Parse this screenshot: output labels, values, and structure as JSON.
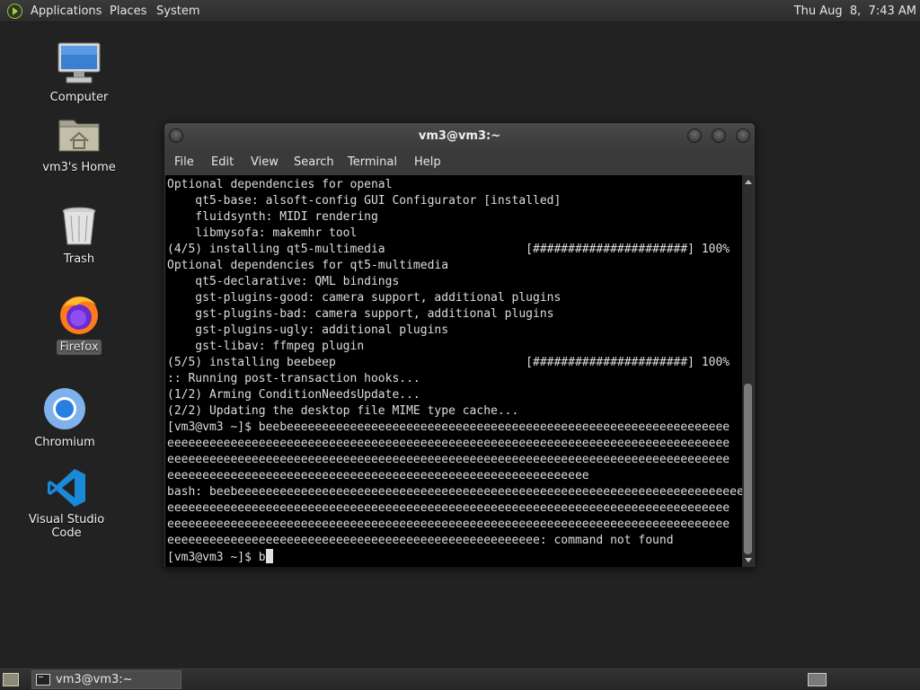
{
  "top_panel": {
    "menu_icon": "gnome-foot-icon",
    "menus": [
      "Applications",
      "Places",
      "System"
    ],
    "clock": "Thu Aug  8,  7:43 AM"
  },
  "desktop": {
    "icons": [
      {
        "label": "Computer",
        "icon": "computer-icon"
      },
      {
        "label": "vm3's Home",
        "icon": "home-folder-icon"
      },
      {
        "label": "Trash",
        "icon": "trash-icon"
      },
      {
        "label": "Firefox",
        "icon": "firefox-icon",
        "selected": true
      },
      {
        "label": "Chromium",
        "icon": "chromium-icon"
      },
      {
        "label": "Visual Studio Code",
        "icon": "vscode-icon"
      }
    ]
  },
  "terminal": {
    "title": "vm3@vm3:~",
    "menu": [
      "File",
      "Edit",
      "View",
      "Search",
      "Terminal",
      "Help"
    ],
    "lines": [
      "Optional dependencies for openal",
      "    qt5-base: alsoft-config GUI Configurator [installed]",
      "    fluidsynth: MIDI rendering",
      "    libmysofa: makemhr tool",
      "(4/5) installing qt5-multimedia                    [######################] 100%",
      "Optional dependencies for qt5-multimedia",
      "    qt5-declarative: QML bindings",
      "    gst-plugins-good: camera support, additional plugins",
      "    gst-plugins-bad: camera support, additional plugins",
      "    gst-plugins-ugly: additional plugins",
      "    gst-libav: ffmpeg plugin",
      "(5/5) installing beebeep                           [######################] 100%",
      ":: Running post-transaction hooks...",
      "(1/2) Arming ConditionNeedsUpdate...",
      "(2/2) Updating the desktop file MIME type cache...",
      "[vm3@vm3 ~]$ beebeeeeeeeeeeeeeeeeeeeeeeeeeeeeeeeeeeeeeeeeeeeeeeeeeeeeeeeeeeeeeee",
      "eeeeeeeeeeeeeeeeeeeeeeeeeeeeeeeeeeeeeeeeeeeeeeeeeeeeeeeeeeeeeeeeeeeeeeeeeeeeeeee",
      "eeeeeeeeeeeeeeeeeeeeeeeeeeeeeeeeeeeeeeeeeeeeeeeeeeeeeeeeeeeeeeeeeeeeeeeeeeeeeeee",
      "eeeeeeeeeeeeeeeeeeeeeeeeeeeeeeeeeeeeeeeeeeeeeeeeeeeeeeeeeeee",
      "bash: beebeeeeeeeeeeeeeeeeeeeeeeeeeeeeeeeeeeeeeeeeeeeeeeeeeeeeeeeeeeeeeeeeeeeeeeeee",
      "eeeeeeeeeeeeeeeeeeeeeeeeeeeeeeeeeeeeeeeeeeeeeeeeeeeeeeeeeeeeeeeeeeeeeeeeeeeeeeee",
      "eeeeeeeeeeeeeeeeeeeeeeeeeeeeeeeeeeeeeeeeeeeeeeeeeeeeeeeeeeeeeeeeeeeeeeeeeeeeeeee",
      "eeeeeeeeeeeeeeeeeeeeeeeeeeeeeeeeeeeeeeeeeeeeeeeeeeeee: command not found"
    ],
    "prompt": "[vm3@vm3 ~]$ b"
  },
  "bottom_panel": {
    "show_desktop_icon": "show-desktop-icon",
    "task_label": "vm3@vm3:~",
    "task_icon": "terminal-icon",
    "workspace_icon": "workspace-switcher-icon"
  }
}
